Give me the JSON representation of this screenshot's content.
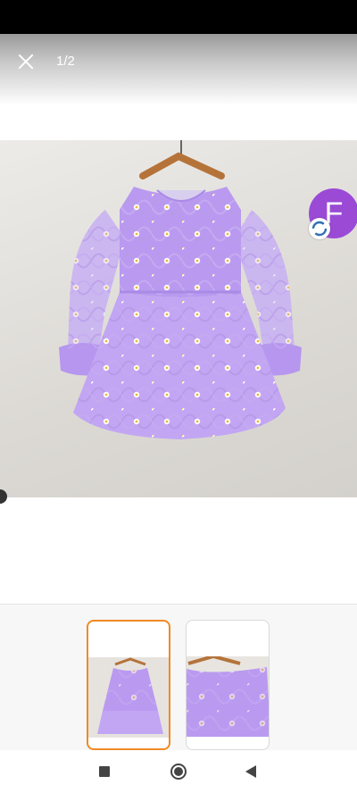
{
  "viewer": {
    "page_counter": "1/2",
    "close_icon": "close-icon"
  },
  "seller": {
    "avatar_letter": "F",
    "avatar_color": "#9b4ad6",
    "badge_icon": "sync-icon"
  },
  "image": {
    "subject": "lavender-daisy-dress-photo"
  },
  "thumbnails": {
    "selected_index": 0,
    "accent": "#f08a24"
  },
  "nav": {
    "recents_icon": "square-icon",
    "home_icon": "circle-icon",
    "back_icon": "triangle-back-icon"
  }
}
